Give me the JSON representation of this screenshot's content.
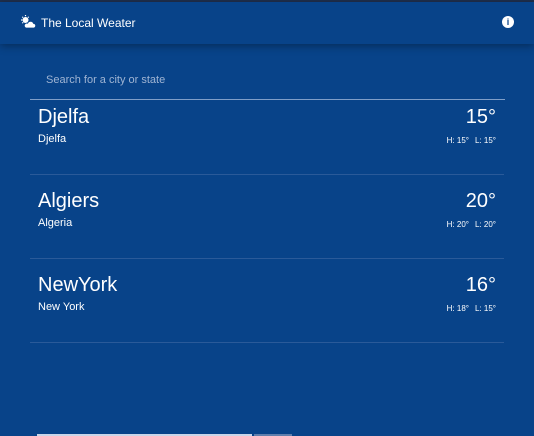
{
  "header": {
    "title": "The Local Weater",
    "logo_icon": "cloud-sun-icon",
    "info_icon": "info-icon"
  },
  "search": {
    "placeholder": "Search for a city or state",
    "value": ""
  },
  "cities": [
    {
      "name": "Djelfa",
      "region": "Djelfa",
      "temp": "15°",
      "high": "H: 15°",
      "low": "L: 15°"
    },
    {
      "name": "Algiers",
      "region": "Algeria",
      "temp": "20°",
      "high": "H: 20°",
      "low": "L: 20°"
    },
    {
      "name": "NewYork",
      "region": "New York",
      "temp": "16°",
      "high": "H: 18°",
      "low": "L: 15°"
    }
  ],
  "colors": {
    "background": "#084389",
    "text": "#ffffff",
    "divider": "#2a5a99"
  }
}
